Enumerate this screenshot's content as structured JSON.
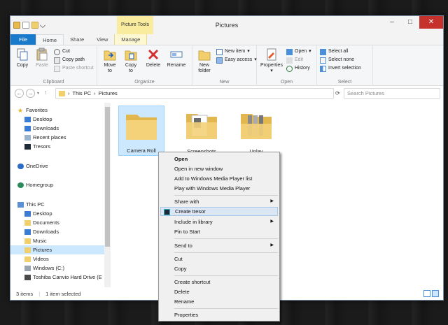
{
  "window": {
    "title": "Pictures",
    "context_tab_header": "Picture Tools"
  },
  "tabs": [
    "File",
    "Home",
    "Share",
    "View",
    "Manage"
  ],
  "ribbon": {
    "clipboard": {
      "label": "Clipboard",
      "copy": "Copy",
      "paste": "Paste",
      "cut": "Cut",
      "copy_path": "Copy path",
      "paste_shortcut": "Paste shortcut"
    },
    "organize": {
      "label": "Organize",
      "move_to": "Move\nto",
      "copy_to": "Copy\nto",
      "delete": "Delete",
      "rename": "Rename"
    },
    "new": {
      "label": "New",
      "new_folder": "New\nfolder",
      "new_item": "New item",
      "easy_access": "Easy access"
    },
    "open": {
      "label": "Open",
      "properties": "Properties",
      "open": "Open",
      "edit": "Edit",
      "history": "History"
    },
    "select": {
      "label": "Select",
      "select_all": "Select all",
      "select_none": "Select none",
      "invert_selection": "Invert selection"
    }
  },
  "address": {
    "crumbs": [
      "This PC",
      "Pictures"
    ],
    "search_placeholder": "Search Pictures"
  },
  "sidebar": {
    "items": [
      "Favorites",
      "Desktop",
      "Downloads",
      "Recent places",
      "Tresors",
      "OneDrive",
      "Homegroup",
      "This PC",
      "Desktop",
      "Documents",
      "Downloads",
      "Music",
      "Pictures",
      "Videos",
      "Windows (C:)",
      "Toshiba Canvio Hard Drive (E"
    ]
  },
  "folders": [
    "Camera Roll",
    "Screenshots",
    "Unlay"
  ],
  "status": {
    "count": "3 items",
    "selected": "1 item selected"
  },
  "context_menu": {
    "items": [
      "Open",
      "Open in new window",
      "Add to Windows Media Player list",
      "Play with Windows Media Player",
      "Share with",
      "Create tresor",
      "Include in library",
      "Pin to Start",
      "Send to",
      "Cut",
      "Copy",
      "Create shortcut",
      "Delete",
      "Rename",
      "Properties"
    ]
  },
  "colors": {
    "accent": "#1979ca",
    "selection": "#cce8ff",
    "folder": "#f4d27a",
    "close": "#c7312b"
  }
}
